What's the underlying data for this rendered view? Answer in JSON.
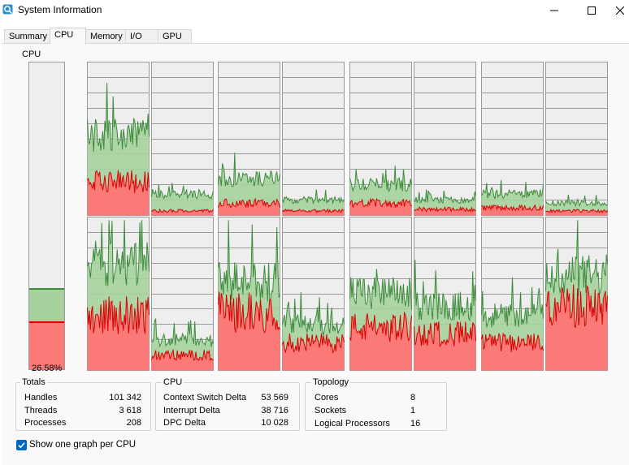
{
  "window": {
    "title": "System Information"
  },
  "tabs": [
    {
      "label": "Summary"
    },
    {
      "label": "CPU"
    },
    {
      "label": "Memory"
    },
    {
      "label": "I/O"
    },
    {
      "label": "GPU"
    }
  ],
  "cpu": {
    "graph_label": "CPU",
    "usage_label": "26.58%",
    "usage_total": 0.2658,
    "usage_kernel": 0.155,
    "colors": {
      "total_fill": "#a6d19d",
      "total_line": "#3d8b3d",
      "kernel_fill": "#fb7a78",
      "kernel_line": "#d80000",
      "grid": "#9a9a9a",
      "background": "#eeeeee"
    },
    "per_cpu": [
      {
        "cpu": 1,
        "total": 0.52,
        "kernel": 0.22
      },
      {
        "cpu": 2,
        "total": 0.14,
        "kernel": 0.03
      },
      {
        "cpu": 3,
        "total": 0.24,
        "kernel": 0.08
      },
      {
        "cpu": 4,
        "total": 0.1,
        "kernel": 0.03
      },
      {
        "cpu": 5,
        "total": 0.2,
        "kernel": 0.08
      },
      {
        "cpu": 6,
        "total": 0.1,
        "kernel": 0.04
      },
      {
        "cpu": 7,
        "total": 0.14,
        "kernel": 0.05
      },
      {
        "cpu": 8,
        "total": 0.08,
        "kernel": 0.03
      },
      {
        "cpu": 9,
        "total": 0.7,
        "kernel": 0.36
      },
      {
        "cpu": 10,
        "total": 0.2,
        "kernel": 0.1
      },
      {
        "cpu": 11,
        "total": 0.58,
        "kernel": 0.38
      },
      {
        "cpu": 12,
        "total": 0.3,
        "kernel": 0.18
      },
      {
        "cpu": 13,
        "total": 0.5,
        "kernel": 0.28
      },
      {
        "cpu": 14,
        "total": 0.42,
        "kernel": 0.24
      },
      {
        "cpu": 15,
        "total": 0.36,
        "kernel": 0.18
      },
      {
        "cpu": 16,
        "total": 0.62,
        "kernel": 0.42
      }
    ]
  },
  "totals": {
    "title": "Totals",
    "handles_label": "Handles",
    "handles": "101 342",
    "threads_label": "Threads",
    "threads": "3 618",
    "processes_label": "Processes",
    "processes": "208"
  },
  "cpu_stats": {
    "title": "CPU",
    "context_switch_label": "Context Switch Delta",
    "context_switch": "53 569",
    "interrupt_label": "Interrupt Delta",
    "interrupt": "38 716",
    "dpc_label": "DPC Delta",
    "dpc": "10 028"
  },
  "topology": {
    "title": "Topology",
    "cores_label": "Cores",
    "cores": "8",
    "sockets_label": "Sockets",
    "sockets": "1",
    "logical_label": "Logical Processors",
    "logical": "16"
  },
  "options": {
    "show_one_graph_label": "Show one graph per CPU",
    "show_one_graph_checked": true
  }
}
